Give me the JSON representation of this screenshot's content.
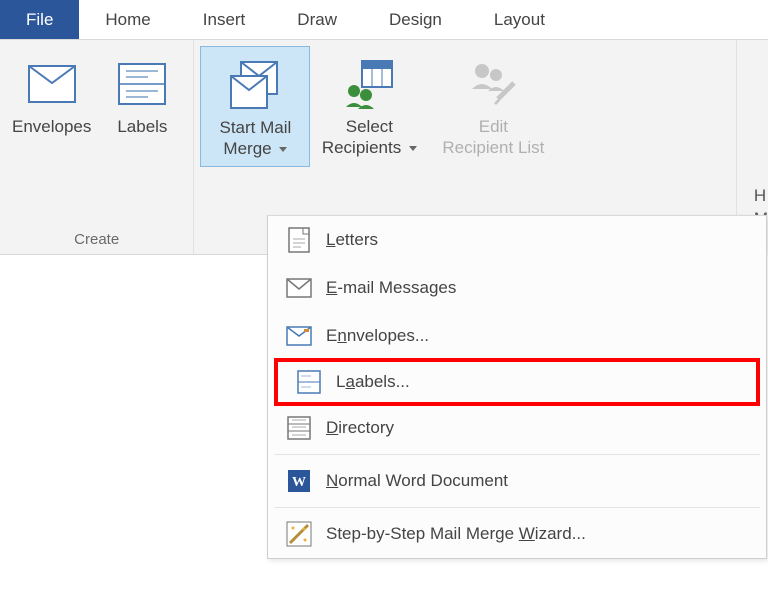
{
  "tabs": {
    "file": "File",
    "home": "Home",
    "insert": "Insert",
    "draw": "Draw",
    "design": "Design",
    "layout": "Layout"
  },
  "groups": {
    "create": {
      "label": "Create",
      "envelopes": "Envelopes",
      "labels": "Labels"
    },
    "mailmerge_group": {
      "start_l1": "Start Mail",
      "start_l2": "Merge",
      "select_l1": "Select",
      "select_l2": "Recipients",
      "edit_l1": "Edit",
      "edit_l2": "Recipient List"
    }
  },
  "menu": {
    "letters": "etters",
    "email": "-mail Messages",
    "envelopes": "nvelopes...",
    "labels": "abels...",
    "directory": "irectory",
    "normal": "ormal Word Document",
    "wizard_pre": "Step-by-Step Mail Merge ",
    "wizard_post": "izard..."
  }
}
